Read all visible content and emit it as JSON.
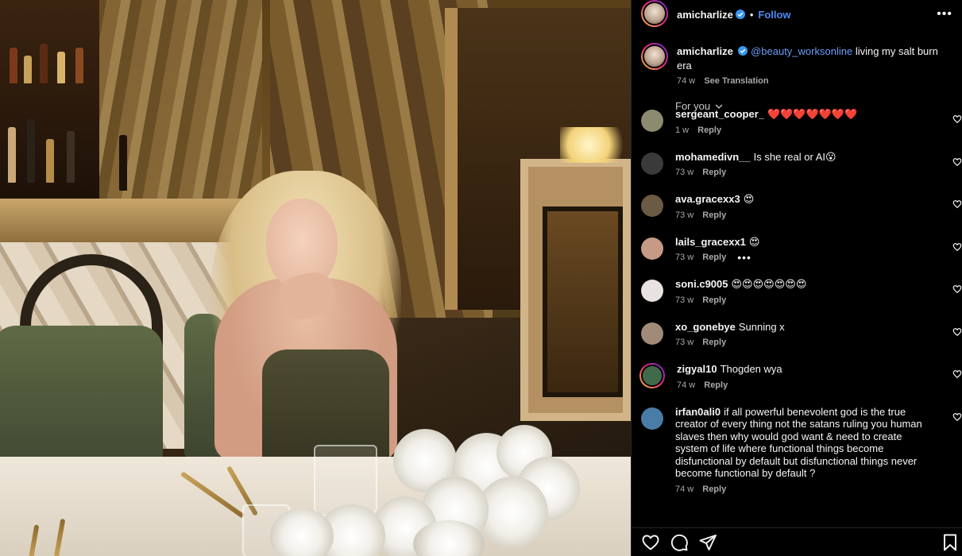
{
  "post": {
    "author": {
      "username": "amicharlize",
      "verified": true,
      "follow_label": "Follow"
    },
    "more_icon": "more-horizontal-icon",
    "caption": {
      "username": "amicharlize",
      "mention": "@beauty_worksonline",
      "text": "living my salt burn era",
      "time": "74 w",
      "see_translation": "See Translation"
    },
    "filter_label": "For you"
  },
  "comments": [
    {
      "username": "sergeant_cooper_",
      "text": "❤️❤️❤️❤️❤️❤️❤️",
      "time": "1 w",
      "reply": "Reply",
      "avatar_color": "#8c8a6f",
      "story": false
    },
    {
      "username": "mohamedivn__",
      "text": "Is she real or AI😮",
      "time": "73 w",
      "reply": "Reply",
      "avatar_color": "#3a3a3a",
      "story": false
    },
    {
      "username": "ava.gracexx3",
      "text": "😍",
      "time": "73 w",
      "reply": "Reply",
      "avatar_color": "#6b5a44",
      "story": false
    },
    {
      "username": "lails_gracexx1",
      "text": "😍",
      "time": "73 w",
      "reply": "Reply",
      "avatar_color": "#c79a86",
      "story": false,
      "show_more": true
    },
    {
      "username": "soni.c9005",
      "text": "😍😍😍😍😍😍😍",
      "time": "73 w",
      "reply": "Reply",
      "avatar_color": "#e8e2e0",
      "story": false
    },
    {
      "username": "xo_gonebye",
      "text": "Sunning x",
      "time": "73 w",
      "reply": "Reply",
      "avatar_color": "#a08a78",
      "story": false
    },
    {
      "username": "zigyal10",
      "text": "Thogden wya",
      "time": "74 w",
      "reply": "Reply",
      "avatar_color": "#3f6b4a",
      "story": true
    },
    {
      "username": "irfan0ali0",
      "text": "if all powerful benevolent god is the true creator of every thing not the satans ruling you human slaves then why would god want & need to create system of life where functional things become disfunctional by default but disfunctional things never become functional by default ?",
      "time": "74 w",
      "reply": "Reply",
      "avatar_color": "#4a7ca8",
      "story": false
    }
  ],
  "actions": {
    "like_icon": "heart-icon",
    "comment_icon": "comment-icon",
    "share_icon": "send-icon",
    "save_icon": "bookmark-icon"
  },
  "colors": {
    "accent": "#4c8bf5",
    "mention": "#6d9cf7",
    "muted": "#a8a8a8",
    "background": "#000000"
  }
}
